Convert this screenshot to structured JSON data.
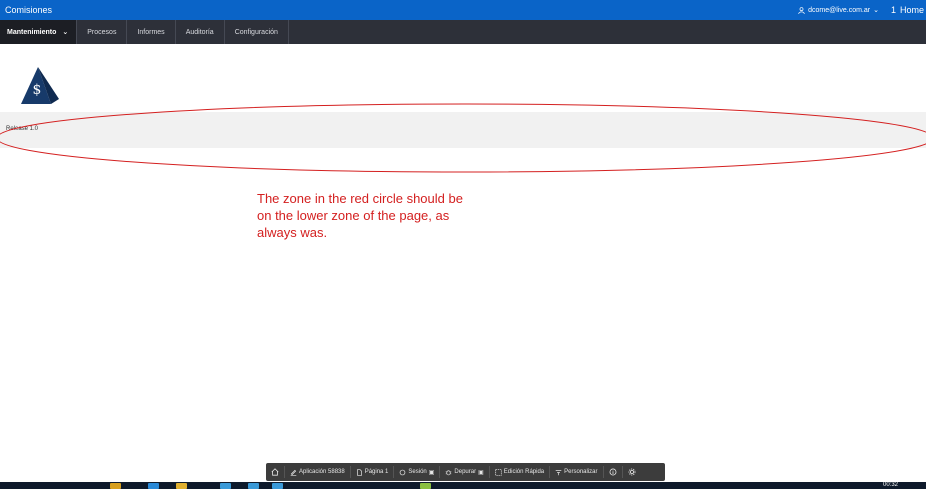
{
  "window": {
    "app_title": "Comisiones",
    "user_email": "dcome@live.com.ar",
    "home_number": "1",
    "home_label": "Home"
  },
  "nav": {
    "items": [
      {
        "label": "Mantenimiento",
        "active": true
      },
      {
        "label": "Procesos"
      },
      {
        "label": "Informes"
      },
      {
        "label": "Auditoría"
      },
      {
        "label": "Configuración"
      }
    ]
  },
  "logo": {
    "symbol": "$",
    "color": "#173a6a"
  },
  "band": {
    "release": "Release 1.0"
  },
  "annotation": {
    "text": "The zone in the red circle should be on the lower zone of the page, as always was.",
    "color": "#d42020"
  },
  "dev_toolbar": {
    "home_icon": "home-icon",
    "application": "Aplicación 58838",
    "page": "Página 1",
    "session": "Sesión",
    "debug": "Depurar",
    "quick_edit": "Edición Rápida",
    "customize": "Personalizar"
  },
  "taskbar": {
    "clock": "00:32"
  },
  "colors": {
    "titlebar": "#0a64c8",
    "navbar": "#2d3039",
    "devbar": "#3c3c3c"
  }
}
